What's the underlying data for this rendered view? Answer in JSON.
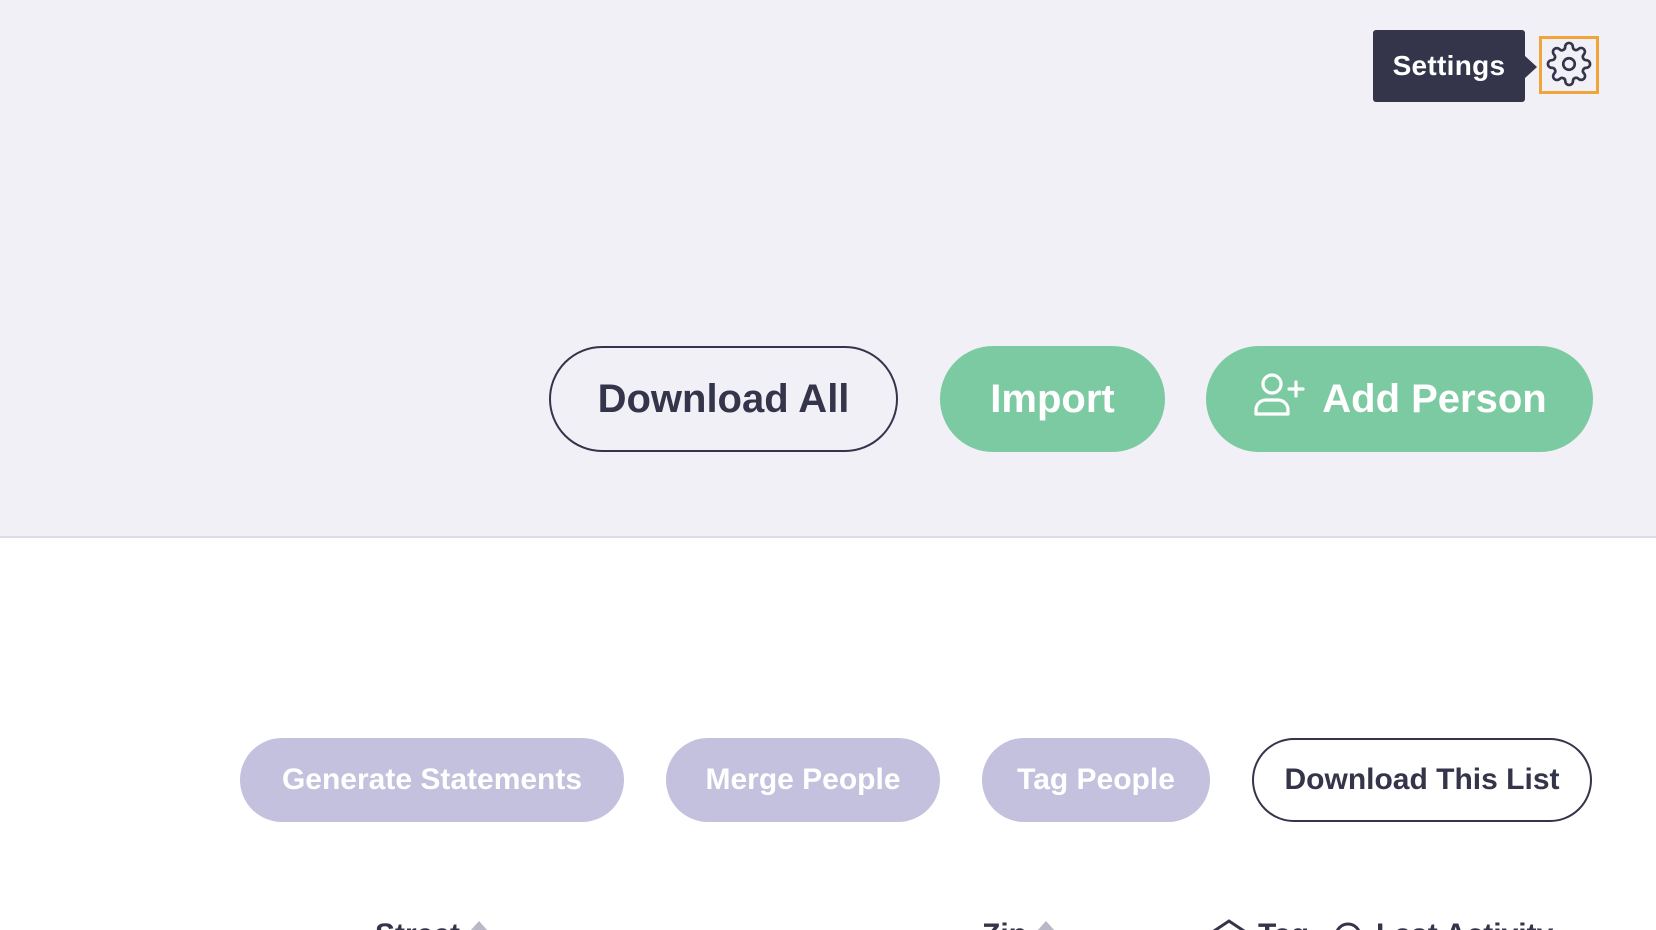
{
  "header": {
    "settings_tooltip": "Settings",
    "settings_icon": "gear-icon",
    "actions": {
      "download_all_label": "Download All",
      "import_label": "Import",
      "add_person_label": "Add Person",
      "add_person_icon": "user-plus-icon"
    }
  },
  "list_actions": {
    "generate_statements_label": "Generate Statements",
    "merge_people_label": "Merge People",
    "tag_people_label": "Tag People",
    "download_list_label": "Download This List"
  },
  "table": {
    "columns": [
      {
        "label": "Street",
        "icon": "sort-icon"
      },
      {
        "label": "Zip",
        "icon": "sort-icon"
      },
      {
        "label": "Tag",
        "icon": "tag-icon"
      },
      {
        "label": "Last Activity",
        "icon": "clock-icon"
      }
    ]
  },
  "colors": {
    "page_bg_top": "#f0f0f6",
    "dark": "#34344a",
    "green": "#7ccaa1",
    "lavender": "#c3c1de",
    "focus": "#f0a43a"
  }
}
